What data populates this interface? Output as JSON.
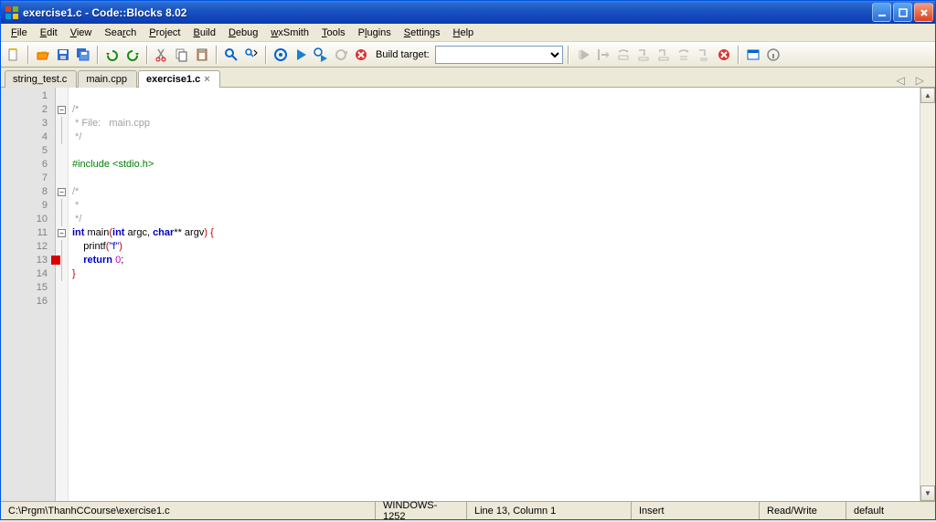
{
  "title": "exercise1.c - Code::Blocks 8.02",
  "menu": [
    "File",
    "Edit",
    "View",
    "Search",
    "Project",
    "Build",
    "Debug",
    "wxSmith",
    "Tools",
    "Plugins",
    "Settings",
    "Help"
  ],
  "build_target_label": "Build target:",
  "build_target_value": "",
  "tabs": [
    {
      "label": "string_test.c",
      "active": false
    },
    {
      "label": "main.cpp",
      "active": false
    },
    {
      "label": "exercise1.c",
      "active": true
    }
  ],
  "code": {
    "lines": [
      {
        "n": 1,
        "fold": "",
        "html": ""
      },
      {
        "n": 2,
        "fold": "box",
        "html": "<span class=\"cm-comment\">/*</span>"
      },
      {
        "n": 3,
        "fold": "line",
        "html": "<span class=\"cm-comment\"> * File:   main.cpp</span>"
      },
      {
        "n": 4,
        "fold": "line",
        "html": "<span class=\"cm-comment\"> */</span>"
      },
      {
        "n": 5,
        "fold": "",
        "html": ""
      },
      {
        "n": 6,
        "fold": "",
        "html": "<span class=\"cm-pp\">#include &lt;stdio.h&gt;</span>"
      },
      {
        "n": 7,
        "fold": "",
        "html": ""
      },
      {
        "n": 8,
        "fold": "box",
        "html": "<span class=\"cm-comment\">/*</span>"
      },
      {
        "n": 9,
        "fold": "line",
        "html": "<span class=\"cm-comment\"> *</span>"
      },
      {
        "n": 10,
        "fold": "line",
        "html": "<span class=\"cm-comment\"> */</span>"
      },
      {
        "n": 11,
        "fold": "box",
        "html": "<span class=\"cm-kw\">int</span> main<span class=\"cm-paren\">(</span><span class=\"cm-kw\">int</span> argc, <span class=\"cm-kw\">char</span>** argv<span class=\"cm-paren\">)</span> <span class=\"cm-brace\">{</span>"
      },
      {
        "n": 12,
        "fold": "line",
        "html": "    printf<span class=\"cm-paren\">(</span><span class=\"cm-str\">\"f\"</span><span class=\"cm-paren\">)</span>"
      },
      {
        "n": 13,
        "fold": "line",
        "bp": true,
        "html": "    <span class=\"cm-kw\">return</span> <span class=\"cm-num\">0</span>;"
      },
      {
        "n": 14,
        "fold": "line",
        "html": "<span class=\"cm-brace\">}</span>"
      },
      {
        "n": 15,
        "fold": "",
        "html": ""
      },
      {
        "n": 16,
        "fold": "",
        "html": ""
      }
    ]
  },
  "status": {
    "path": "C:\\Prgm\\ThanhCCourse\\exercise1.c",
    "encoding": "WINDOWS-1252",
    "position": "Line 13, Column 1",
    "insert": "Insert",
    "rw": "Read/Write",
    "profile": "default"
  }
}
